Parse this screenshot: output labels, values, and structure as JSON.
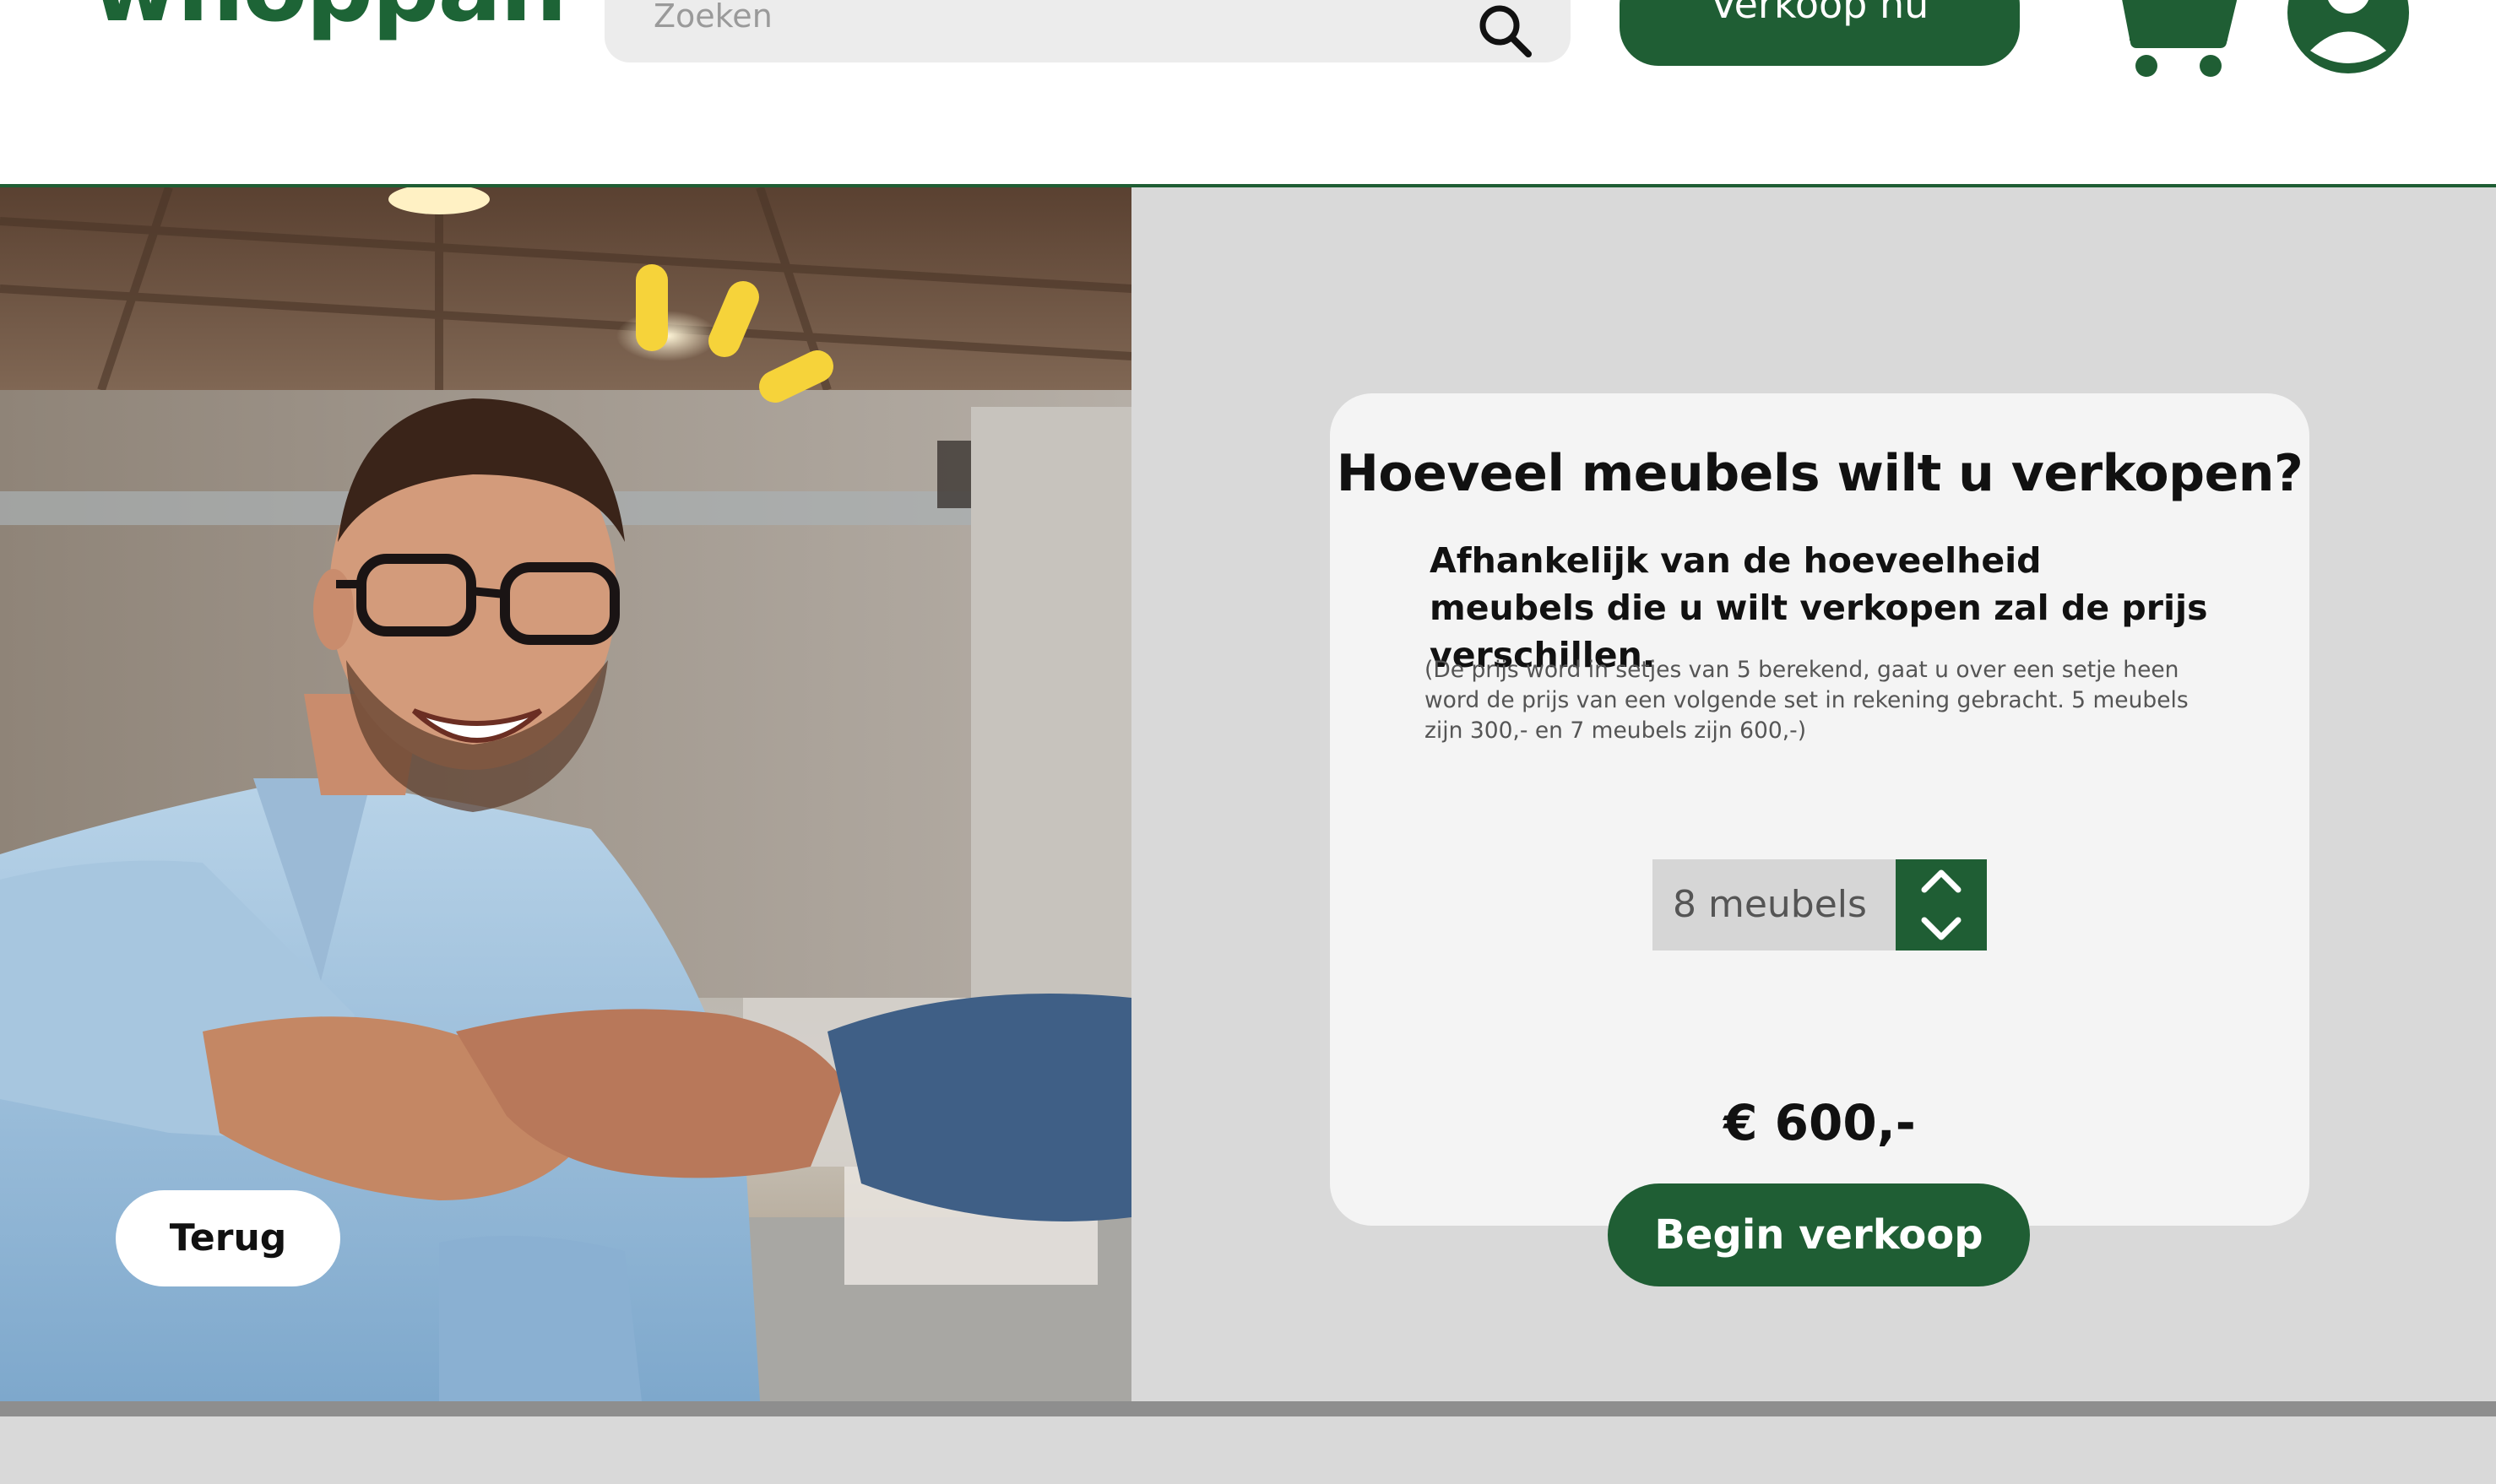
{
  "header": {
    "logo_text": "whoppah",
    "search_placeholder": "Zoeken",
    "sell_now_label": "Verkoop nu",
    "icons": [
      "search-icon",
      "cart-icon",
      "account-icon"
    ]
  },
  "hero": {
    "back_label": "Terug"
  },
  "card": {
    "title": "Hoeveel meubels wilt u verkopen?",
    "subtitle": "Afhankelijk van de hoeveelheid meubels die u wilt verkopen zal de prijs verschillen.",
    "note": "(De prijs word in setjes van 5 berekend, gaat u over een setje heen word de prijs van een volgende set in rekening gebracht. 5 meubels zijn 300,- en 7 meubels zijn 600,-)",
    "quantity_value": "8 meubels",
    "price": "€ 600,-",
    "start_label": "Begin verkoop"
  },
  "colors": {
    "brand_green": "#1f5e34",
    "panel_gray": "#d9d9d9",
    "card_bg": "#f4f4f4",
    "accent_yellow": "#f6d33a"
  }
}
